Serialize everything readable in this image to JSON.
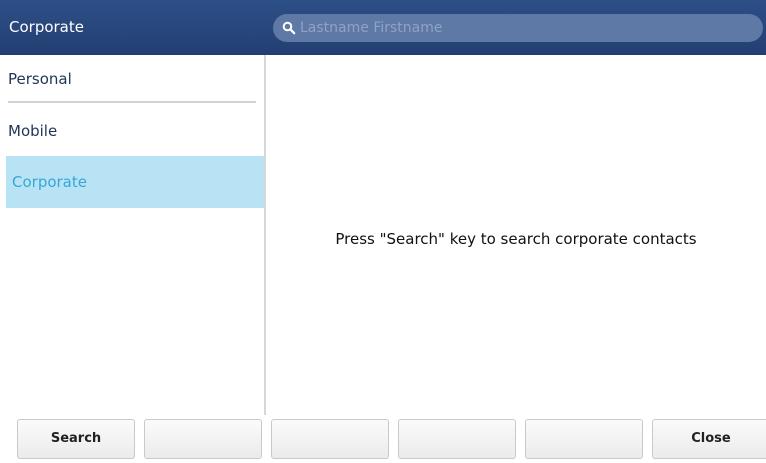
{
  "header": {
    "title": "Corporate",
    "search_placeholder": "Lastname Firstname",
    "search_icon": "search-icon"
  },
  "sidebar": {
    "items": [
      {
        "label": "Personal",
        "selected": false
      },
      {
        "label": "Mobile",
        "selected": false
      },
      {
        "label": "Corporate",
        "selected": true
      }
    ]
  },
  "main": {
    "message": "Press \"Search\" key to search corporate contacts"
  },
  "softkeys": [
    {
      "label": "Search"
    },
    {
      "label": ""
    },
    {
      "label": ""
    },
    {
      "label": ""
    },
    {
      "label": ""
    },
    {
      "label": "Close"
    }
  ],
  "colors": {
    "header_bg": "#2a4a82",
    "selected_bg": "#b8e3f5",
    "selected_text": "#37a7d8"
  }
}
